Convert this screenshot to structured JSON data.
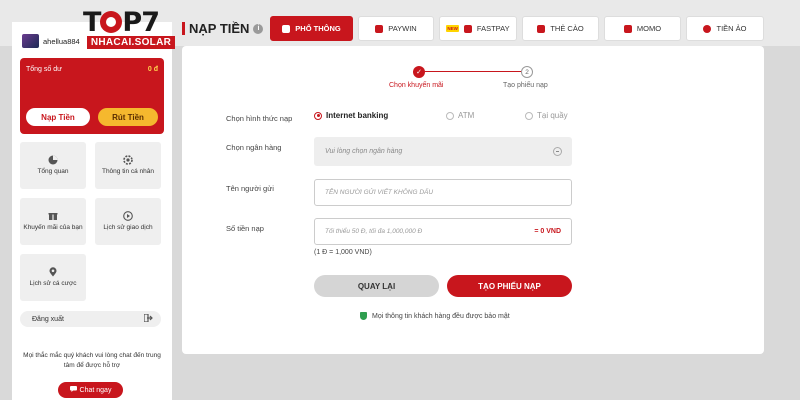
{
  "logo": {
    "main": "TOP7",
    "sub": "NHACAI.SOLAR"
  },
  "sidebar": {
    "username": "ahellua884",
    "balance_label": "Tổng số dư",
    "balance_value": "0 đ",
    "deposit_label": "Nạp Tiền",
    "withdraw_label": "Rút Tiền",
    "menu": [
      {
        "label": "Tổng quan",
        "icon": "pie-chart-icon"
      },
      {
        "label": "Thông tin cá nhân",
        "icon": "gear-icon"
      },
      {
        "label": "Khuyến mãi của bạn",
        "icon": "gift-icon"
      },
      {
        "label": "Lịch sử giao dịch",
        "icon": "play-circle-icon"
      },
      {
        "label": "Lịch sử cá cược",
        "icon": "location-pin-icon"
      }
    ],
    "logout_label": "Đăng xuất",
    "help_text": "Mọi thắc mắc quý khách vui lòng chat đến trung tâm để được hỗ trợ",
    "chat_label": "Chat ngay"
  },
  "header": {
    "title": "NẠP TIỀN",
    "tabs": [
      {
        "label": "PHỔ THÔNG",
        "active": true
      },
      {
        "label": "PAYWIN",
        "active": false
      },
      {
        "label": "FASTPAY",
        "active": false,
        "badge": "NEW"
      },
      {
        "label": "THẺ CÀO",
        "active": false
      },
      {
        "label": "MOMO",
        "active": false
      },
      {
        "label": "TIỀN ẢO",
        "active": false
      }
    ]
  },
  "steps": [
    {
      "number": "✓",
      "label": "Chọn khuyến mãi"
    },
    {
      "number": "2",
      "label": "Tạo phiếu nạp"
    }
  ],
  "form": {
    "method_label": "Chọn hình thức nạp",
    "methods": [
      "Internet banking",
      "ATM",
      "Tại quầy"
    ],
    "selected_method": "Internet banking",
    "bank_label": "Chọn ngân hàng",
    "bank_placeholder": "Vui lòng chọn ngân hàng",
    "sender_label": "Tên người gửi",
    "sender_placeholder": "TÊN NGƯỜI GỬI VIẾT KHÔNG DẤU",
    "amount_label": "Số tiền nạp",
    "amount_placeholder": "Tối thiểu 50 Đ, tối đa 1,000,000 Đ",
    "amount_converted": "= 0 VND",
    "rate_note": "(1 Đ = 1,000 VND)",
    "back_label": "QUAY LẠI",
    "submit_label": "TẠO PHIẾU NẠP",
    "security_note": "Mọi thông tin khách hàng đều được bảo mật"
  },
  "colors": {
    "brand_red": "#c8161d",
    "gold": "#f5b82e",
    "secure_green": "#2e9e4f"
  }
}
